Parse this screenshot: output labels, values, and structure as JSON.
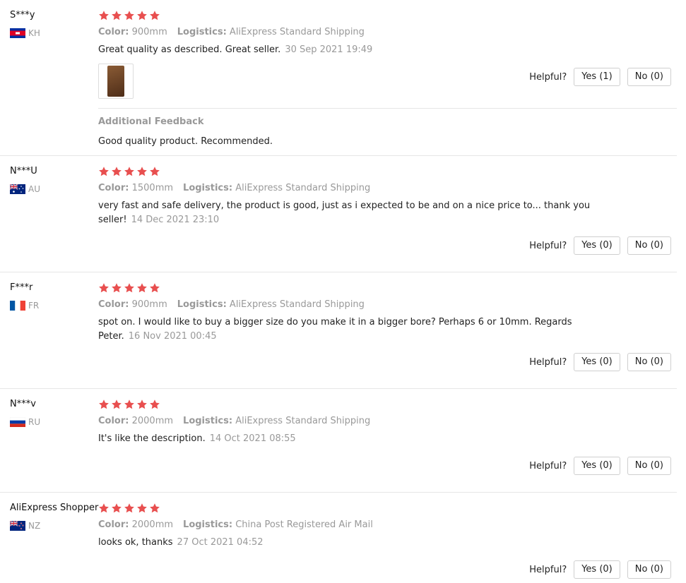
{
  "colors": {
    "star": "#e84f4f",
    "muted": "#999999",
    "text": "#222222"
  },
  "labels": {
    "color": "Color:",
    "logistics": "Logistics:",
    "helpful": "Helpful?",
    "additional_feedback": "Additional Feedback"
  },
  "reviews": [
    {
      "user": "S***y",
      "country": "KH",
      "stars": 5,
      "color": "900mm",
      "logistics": "AliExpress Standard Shipping",
      "text": "Great quality as described. Great seller.",
      "date": "30 Sep 2021 19:49",
      "yes": "Yes (1)",
      "no": "No (0)",
      "additional": "Good quality product. Recommended."
    },
    {
      "user": "N***U",
      "country": "AU",
      "stars": 5,
      "color": "1500mm",
      "logistics": "AliExpress Standard Shipping",
      "text": "very fast and safe delivery, the product is good, just as i expected to be and on a nice price to... thank you seller!",
      "date": "14 Dec 2021 23:10",
      "yes": "Yes (0)",
      "no": "No (0)"
    },
    {
      "user": "F***r",
      "country": "FR",
      "stars": 5,
      "color": "900mm",
      "logistics": "AliExpress Standard Shipping",
      "text": "spot on. I would like to buy a bigger size do you make it in a bigger bore? Perhaps 6 or 10mm. Regards Peter.",
      "date": "16 Nov 2021 00:45",
      "yes": "Yes (0)",
      "no": "No (0)"
    },
    {
      "user": "N***v",
      "country": "RU",
      "stars": 5,
      "color": "2000mm",
      "logistics": "AliExpress Standard Shipping",
      "text": "It's like the description.",
      "date": "14 Oct 2021 08:55",
      "yes": "Yes (0)",
      "no": "No (0)"
    },
    {
      "user": "AliExpress Shopper",
      "country": "NZ",
      "stars": 5,
      "color": "2000mm",
      "logistics": "China Post Registered Air Mail",
      "text": "looks ok, thanks",
      "date": "27 Oct 2021 04:52",
      "yes": "Yes (0)",
      "no": "No (0)"
    }
  ]
}
